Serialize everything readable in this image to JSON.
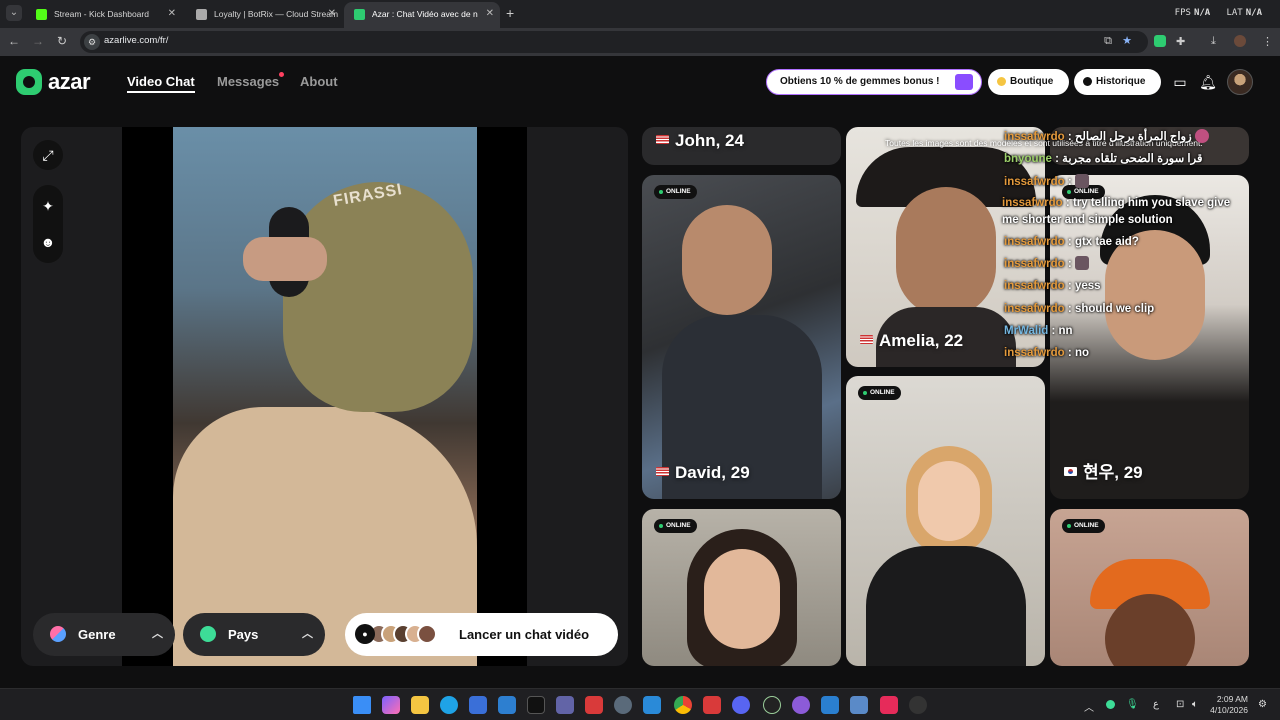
{
  "browser": {
    "tabs": [
      {
        "title": "Stream - Kick Dashboard",
        "fav_color": "#53fc18",
        "active": false
      },
      {
        "title": "Loyalty | BotRix — Cloud Stream",
        "fav_color": "#aaaaaa",
        "active": false
      },
      {
        "title": "Azar : Chat Vidéo avec de n",
        "fav_color": "#2ecc71",
        "active": true
      }
    ],
    "fps_label": "FPS",
    "fps_value": "N/A",
    "lat_label": "LAT",
    "lat_value": "N/A",
    "url": "azarlive.com/fr/"
  },
  "header": {
    "logo": "azar",
    "nav": [
      "Video Chat",
      "Messages",
      "About"
    ],
    "promo": "Obtiens 10 % de gemmes bonus !",
    "boutique": "Boutique",
    "historique": "Historique"
  },
  "left_panel": {
    "cap_text": "FIRASSI",
    "genre_label": "Genre",
    "pays_label": "Pays",
    "launch_label": "Lancer un chat vidéo"
  },
  "gallery": {
    "disclaimer": "Toutes les images sont des modèles et sont utilisées à titre d'illustration uniquement.",
    "online_label": "ONLINE",
    "cards": [
      {
        "name": "John, 24",
        "flag": "us"
      },
      {
        "name": "David, 29",
        "flag": "us"
      },
      {
        "name": "Amelia, 22",
        "flag": "us"
      },
      {
        "name": "현우, 29",
        "flag": "kr"
      }
    ]
  },
  "chat": [
    {
      "user": "inssafwrdo",
      "text": "زواج المرأة برجل الصالح",
      "color": "orange"
    },
    {
      "user": "bnyoune",
      "text": "قرا سورة الضحى تلقاه مجربة",
      "color": "orange"
    },
    {
      "user": "inssafwrdo",
      "text": "",
      "emote": true,
      "color": "orange"
    },
    {
      "user": "inssafwrdo",
      "text": "try telling him you slave give me shorter and simple solution",
      "color": "orange",
      "wrap": true
    },
    {
      "user": "inssafwrdo",
      "text": "gtx tae aid?",
      "color": "orange"
    },
    {
      "user": "inssafwrdo",
      "text": "",
      "emote": true,
      "color": "orange"
    },
    {
      "user": "inssafwrdo",
      "text": "yess",
      "color": "orange"
    },
    {
      "user": "inssafwrdo",
      "text": "should we clip",
      "color": "orange"
    },
    {
      "user": "MrWalid",
      "text": "nn",
      "color": "blue"
    },
    {
      "user": "inssafwrdo",
      "text": "no",
      "color": "orange"
    }
  ],
  "taskbar": {
    "time": "2:09 AM",
    "date": "4/10/2026"
  }
}
